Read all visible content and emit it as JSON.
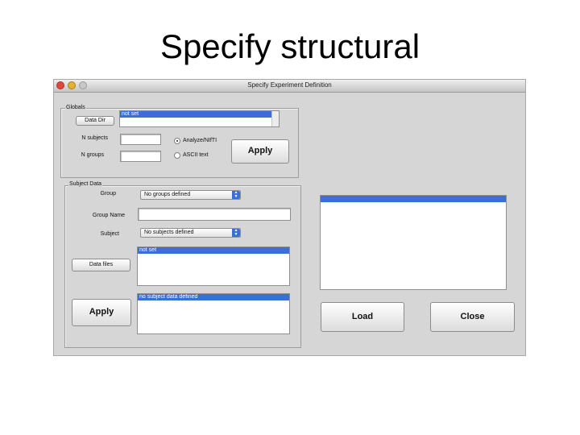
{
  "slide": {
    "title": "Specify structural"
  },
  "window": {
    "title": "Specify Experiment Definition",
    "controls": [
      "close-icon",
      "minimize-icon",
      "zoom-icon"
    ]
  },
  "globals": {
    "group_label": "Globals",
    "data_dir_button": "Data Dir",
    "data_dir_list": [
      "not set"
    ],
    "nsubjects_label": "N subjects",
    "nsubjects_value": "",
    "ngroups_label": "N groups",
    "ngroups_value": "",
    "format_options": [
      {
        "label": "Analyze/NIfTI",
        "selected": true
      },
      {
        "label": "ASCII text",
        "selected": false
      }
    ],
    "apply_button": "Apply"
  },
  "subject_data": {
    "group_label": "Subject Data",
    "group_field_label": "Group",
    "group_select_value": "No groups defined",
    "group_name_label": "Group Name",
    "group_name_value": "",
    "subject_label": "Subject",
    "subject_select_value": "No subjects defined",
    "files_list": [
      "not set"
    ],
    "data_files_button": "Data files",
    "subject_data_list": [
      "no subject data defined"
    ],
    "apply_button": "Apply"
  },
  "right_panel": {
    "list_items": [
      ""
    ],
    "load_button": "Load",
    "close_button": "Close"
  },
  "colors": {
    "selection": "#3a6fd8",
    "window_bg": "#d6d6d6"
  }
}
